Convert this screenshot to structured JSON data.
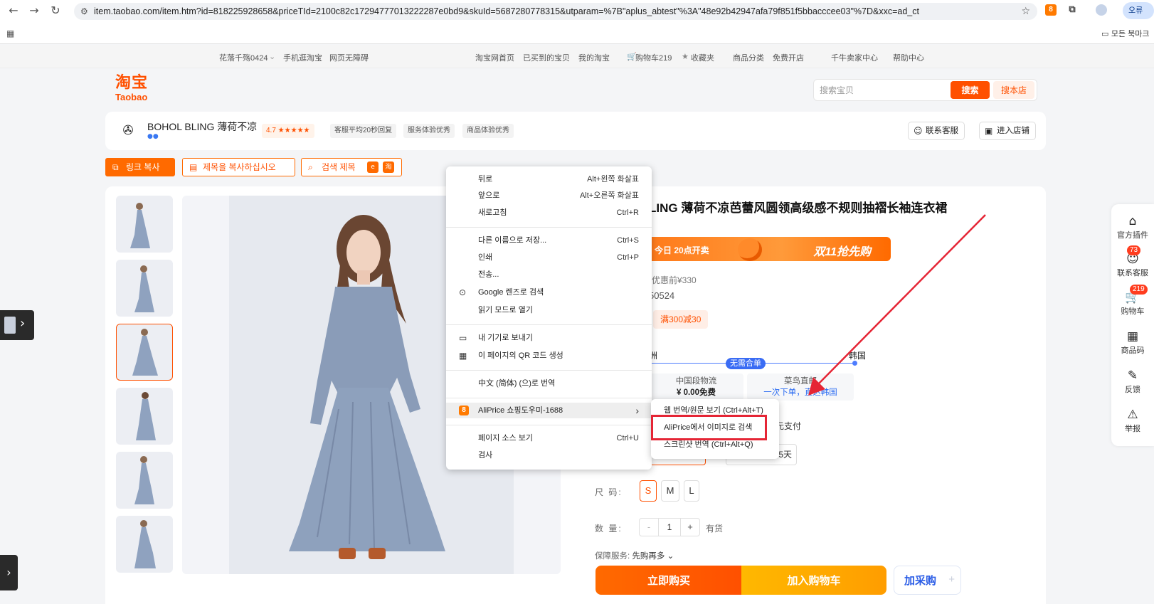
{
  "browser": {
    "back_icon": "back-arrow-icon",
    "url": "item.taobao.com/item.htm?id=818225928658&priceTId=2100c82c17294777013222287e0bd9&skuId=5687280778315&utparam=%7B\"aplus_abtest\"%3A\"48e92b42947afa79f851f5bbacccee03\"%7D&xxc=ad_ct",
    "profile_label": "오류",
    "bookmarks_label": "모든 북마크",
    "ext_badge": "8"
  },
  "top_nav": {
    "left": [
      "花落千殇0424",
      "手机逛淘宝",
      "网页无障碍"
    ],
    "right": [
      "淘宝网首页",
      "已买到的宝贝",
      "我的淘宝",
      "购物车219",
      "收藏夹",
      "商品分类",
      "免费开店",
      "千牛卖家中心",
      "帮助中心"
    ]
  },
  "header": {
    "logo_cn": "淘宝",
    "logo_en": "Taobao",
    "search_placeholder": "搜索宝贝",
    "search_button": "搜索",
    "search_shop_button": "搜本店"
  },
  "store": {
    "name": "BOHOL BLING 薄荷不凉",
    "badges_icon": "●●",
    "rating": "4.7 ★★★★★",
    "badges": [
      "客服平均20秒回复",
      "服务体验优秀",
      "商品体验优秀"
    ],
    "contact_button": "联系客服",
    "enter_store_button": "进入店铺"
  },
  "aliprice_toolbar": {
    "copy_link": "링크 복사",
    "copy_title": "제목을 복사하십시오",
    "search_title": "검색 제목",
    "mini_a": "e",
    "mini_b": "淘"
  },
  "product": {
    "title": "LING 薄荷不凉芭蕾风圆领高级感不规则抽褶长袖连衣裙",
    "promo_left": "今日 20点开卖",
    "promo_right": "双11抢先购",
    "original_price": "优惠前¥330",
    "code": "50524",
    "coupon": "满300减30",
    "route_from": "洲",
    "route_to": "韩国",
    "route_badge": "无需合单",
    "ship_china_title": "中国段物流",
    "ship_china_price": "¥ 0.00免费",
    "ship_cainiao_title": "菜鸟直邮",
    "ship_cainiao_sub": "一次下单，直达韩国",
    "pay_text": "元支付",
    "option_days": "5天",
    "size_label": "尺  码:",
    "sizes": [
      "S",
      "M",
      "L"
    ],
    "qty_label": "数  量:",
    "qty_minus": "-",
    "qty_value": "1",
    "qty_plus": "+",
    "stock": "有货",
    "insurance_label": "保障服务:",
    "insurance_value": "先购再多",
    "buy_now": "立即购买",
    "add_cart": "加入购物车",
    "add_purchase": "加采购",
    "add_purchase_plus": "+"
  },
  "right_sidebar": [
    {
      "label": "官方插件",
      "icon": "plugin-icon"
    },
    {
      "label": "联系客服",
      "icon": "chat-icon",
      "badge": "73"
    },
    {
      "label": "购物车",
      "icon": "cart-icon",
      "badge": "219"
    },
    {
      "label": "商品码",
      "icon": "qr-icon"
    },
    {
      "label": "反馈",
      "icon": "edit-icon"
    },
    {
      "label": "举报",
      "icon": "warning-icon"
    }
  ],
  "context_menu": {
    "items": [
      {
        "label": "뒤로",
        "shortcut": "Alt+왼쪽 화살표"
      },
      {
        "label": "앞으로",
        "shortcut": "Alt+오른쪽 화살표"
      },
      {
        "label": "새로고침",
        "shortcut": "Ctrl+R"
      },
      {
        "label": "다른 이름으로 저장...",
        "shortcut": "Ctrl+S"
      },
      {
        "label": "인쇄",
        "shortcut": "Ctrl+P"
      },
      {
        "label": "전송...",
        "shortcut": ""
      },
      {
        "label": "Google 렌즈로 검색",
        "shortcut": ""
      },
      {
        "label": "읽기 모드로 열기",
        "shortcut": ""
      },
      {
        "label": "내 기기로 보내기",
        "shortcut": ""
      },
      {
        "label": "이 페이지의 QR 코드 생성",
        "shortcut": ""
      },
      {
        "label": "中文 (简体) (으)로 번역",
        "shortcut": ""
      },
      {
        "label": "AliPrice 쇼핑도우미-1688",
        "shortcut": "›"
      },
      {
        "label": "페이지 소스 보기",
        "shortcut": "Ctrl+U"
      },
      {
        "label": "검사",
        "shortcut": ""
      }
    ],
    "submenu": [
      "웹 번역/원문 보기 (Ctrl+Alt+T)",
      "AliPrice에서 이미지로 검색",
      "스크린샷 번역 (Ctrl+Alt+Q)"
    ]
  },
  "colors": {
    "brand": "#ff5000",
    "annotation_red": "#e52535"
  }
}
